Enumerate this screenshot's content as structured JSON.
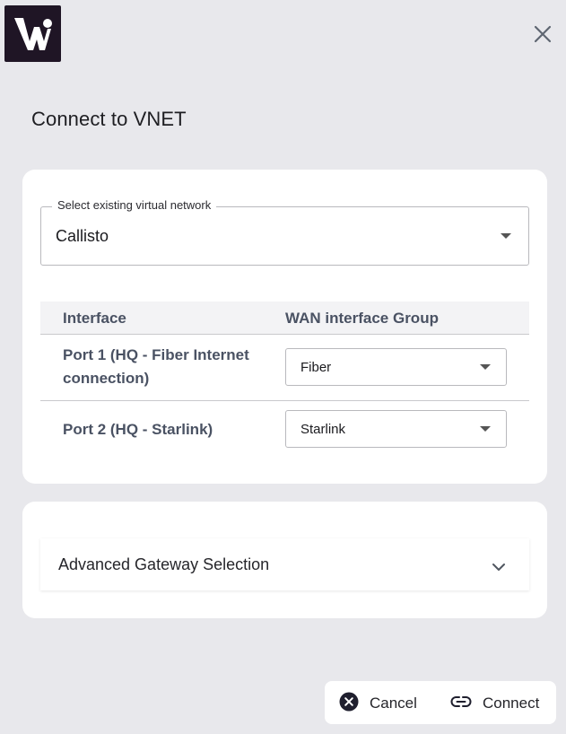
{
  "dialog": {
    "title": "Connect to VNET"
  },
  "vnet": {
    "label": "Select existing virtual network",
    "value": "Callisto"
  },
  "interfaces": {
    "headers": [
      "Interface",
      "WAN interface Group"
    ],
    "rows": [
      {
        "port": "Port 1 (HQ - Fiber Internet connection)",
        "group": "Fiber"
      },
      {
        "port": "Port 2 (HQ - Starlink)",
        "group": "Starlink"
      }
    ]
  },
  "advanced": {
    "title": "Advanced Gateway Selection"
  },
  "actions": {
    "cancel": "Cancel",
    "connect": "Connect"
  },
  "colors": {
    "background": "#e8e8ec",
    "card": "#ffffff",
    "logo_bg": "#1f1525",
    "header_text": "#4a5263"
  },
  "icons": {
    "logo": "brand-logo-icon",
    "close": "close-icon",
    "dropdown": "caret-down-icon",
    "expand": "chevron-down-icon",
    "cancel": "cancel-circle-icon",
    "connect": "link-icon"
  }
}
